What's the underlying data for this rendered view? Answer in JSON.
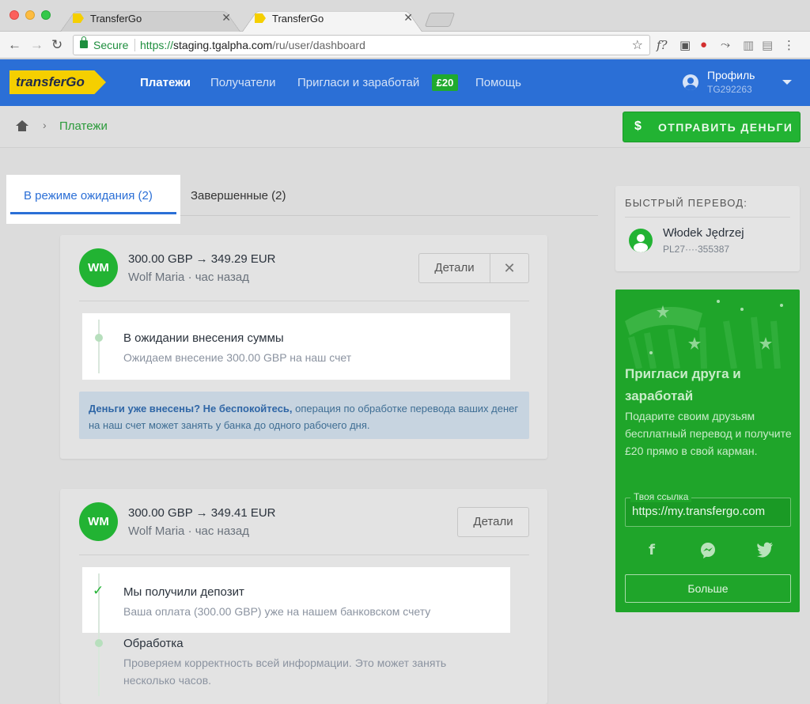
{
  "browser": {
    "tabs": [
      {
        "title": "TransferGo"
      },
      {
        "title": "TransferGo"
      }
    ],
    "secure_label": "Secure",
    "url_proto": "https://",
    "url_host": "staging.tgalpha.com",
    "url_path": "/ru/user/dashboard"
  },
  "header": {
    "logo": "transferGo",
    "nav": [
      "Платежи",
      "Получатели",
      "Пригласи и заработай",
      "Помощь"
    ],
    "invite_badge": "£20",
    "profile_name": "Профиль",
    "profile_id": "TG292263"
  },
  "breadcrumb": {
    "current": "Платежи"
  },
  "send_button": {
    "icon": "$",
    "label": "ОТПРАВИТЬ ДЕНЬГИ"
  },
  "tabs": {
    "pending": "В режиме ожидания (2)",
    "completed": "Завершенные (2)"
  },
  "transfers": [
    {
      "initials": "WM",
      "amount": "300.00 GBP  →  349.29 EUR",
      "meta": "Wolf Maria · час назад",
      "details_label": "Детали",
      "steps": [
        {
          "title": "В ожидании внесения суммы",
          "subtitle": "Ожидаем внесение 300.00 GBP на наш счет"
        }
      ],
      "note_bold": "Деньги уже внесены? Не беспокойтесь,",
      "note_text": "операция по обработке перевода ваших денег на наш счет может занять у банка до одного рабочего дня."
    },
    {
      "initials": "WM",
      "amount": "300.00 GBP  →  349.41 EUR",
      "meta": "Wolf Maria · час назад",
      "details_label": "Детали",
      "steps": [
        {
          "title": "Мы получили депозит",
          "subtitle": "Ваша оплата (300.00 GBP) уже на нашем банковском счету"
        },
        {
          "title": "Обработка",
          "subtitle_line1": "Проверяем корректность всей информации. Это может занять",
          "subtitle_line2": "несколько часов."
        }
      ]
    }
  ],
  "quick_transfer": {
    "title": "БЫСТРЫЙ ПЕРЕВОД:",
    "name": "Włodek Jędrzej",
    "account": "PL27····355387"
  },
  "invite": {
    "title": "Пригласи друга и заработай",
    "text": "Подарите своим друзьям бесплатный перевод и получите £20 прямо в свой карман.",
    "link_label": "Твоя ссылка",
    "link_value": "https://my.transfergo.com",
    "social": [
      "f",
      "m",
      "t"
    ],
    "more_label": "Больше"
  }
}
